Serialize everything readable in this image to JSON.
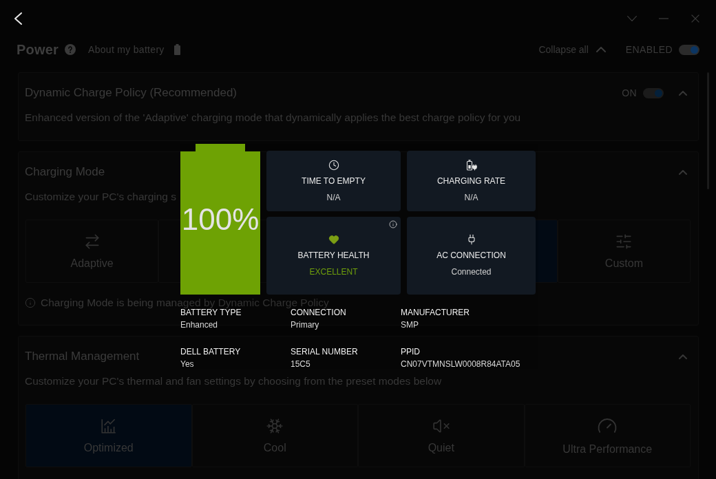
{
  "header": {
    "title": "Power",
    "link": "About my battery",
    "collapse_all": "Collapse all",
    "master_switch": {
      "label": "ENABLED",
      "on": true
    }
  },
  "sections": [
    {
      "kind": "toggle",
      "title": "Dynamic Charge Policy (Recommended)",
      "expanded": true,
      "switch": {
        "label": "ON",
        "on": true
      },
      "description": "Enhanced version of the 'Adaptive' charging mode that dynamically applies the best charge policy for you"
    },
    {
      "kind": "modes",
      "title": "Charging Mode",
      "expanded": true,
      "description": "Customize your PC's charging s",
      "modes": [
        {
          "kind": "adaptive",
          "label": "Adaptive",
          "selected": false
        },
        {
          "selected": false
        },
        {
          "kind": "covered"
        },
        {
          "selected": true
        },
        {
          "kind": "custom",
          "label": "Custom",
          "selected": false
        }
      ],
      "note": "Charging Mode is being managed by Dynamic Charge Policy"
    },
    {
      "kind": "modes",
      "title": "Thermal Management",
      "expanded": true,
      "description": "Customize your PC's thermal and fan settings by choosing from the preset modes below",
      "modes": [
        {
          "kind": "optimized",
          "label": "Optimized",
          "selected": true
        },
        {
          "kind": "cool",
          "label": "Cool",
          "selected": false
        },
        {
          "kind": "quiet",
          "label": "Quiet",
          "selected": false
        },
        {
          "kind": "performance",
          "label": "Ultra Performance",
          "selected": false
        }
      ]
    }
  ],
  "battery": {
    "charge": "100%",
    "level": 1,
    "tiles": [
      {
        "kind": "time",
        "title": "TIME TO EMPTY",
        "value": "N/A"
      },
      {
        "kind": "rate",
        "title": "CHARGING RATE",
        "value": "N/A"
      },
      {
        "kind": "health",
        "title": "BATTERY HEALTH",
        "value": "EXCELLENT"
      },
      {
        "kind": "ac",
        "title": "AC CONNECTION",
        "value": "Connected"
      }
    ],
    "details": [
      {
        "label": "BATTERY TYPE",
        "value": "Enhanced"
      },
      {
        "label": "CONNECTION",
        "value": "Primary"
      },
      {
        "label": "MANUFACTURER",
        "value": "SMP"
      },
      {
        "label": "DELL BATTERY",
        "value": "Yes"
      },
      {
        "label": "SERIAL NUMBER",
        "value": "15C5"
      },
      {
        "label": "PPID",
        "value": "CN07VTMNSLW0008R84ATA05"
      }
    ]
  }
}
